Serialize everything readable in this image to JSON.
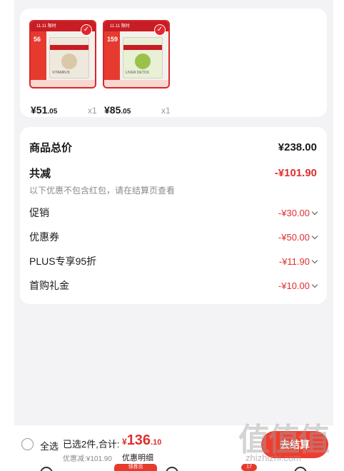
{
  "products": [
    {
      "price_int": "¥51",
      "price_dec": ".05",
      "qty": "x1",
      "badge_price": "56",
      "box_name": "VITAMIN B",
      "selected": true
    },
    {
      "price_int": "¥85",
      "price_dec": ".05",
      "qty": "x1",
      "badge_price": "159",
      "box_name": "LIVER DETOX",
      "selected": true
    }
  ],
  "summary": {
    "total_label": "商品总价",
    "total_value": "¥238.00",
    "reduce_label": "共减",
    "reduce_value": "-¥101.90",
    "note": "以下优惠不包含红包，请在结算页查看",
    "items": [
      {
        "label": "促销",
        "value": "-¥30.00"
      },
      {
        "label": "优惠券",
        "value": "-¥50.00"
      },
      {
        "label": "PLUS专享95折",
        "value": "-¥11.90"
      },
      {
        "label": "首购礼金",
        "value": "-¥10.00"
      }
    ]
  },
  "bottom": {
    "select_all": "全选",
    "selected_text": "已选2件,合计:",
    "currency": "¥",
    "amount_int": "136",
    "amount_dec": ".10",
    "discount_text": "优惠减:¥101.90",
    "detail_link": "优惠明细",
    "checkout_label": "去结算",
    "tab_label": "领券页",
    "cart_badge": "17"
  },
  "watermark": {
    "big": "值值值",
    "small": "zhizhizhi.com"
  },
  "colors": {
    "accent": "#e02f2f",
    "checkout": "#f03c2e",
    "background": "#f3f3f5"
  }
}
